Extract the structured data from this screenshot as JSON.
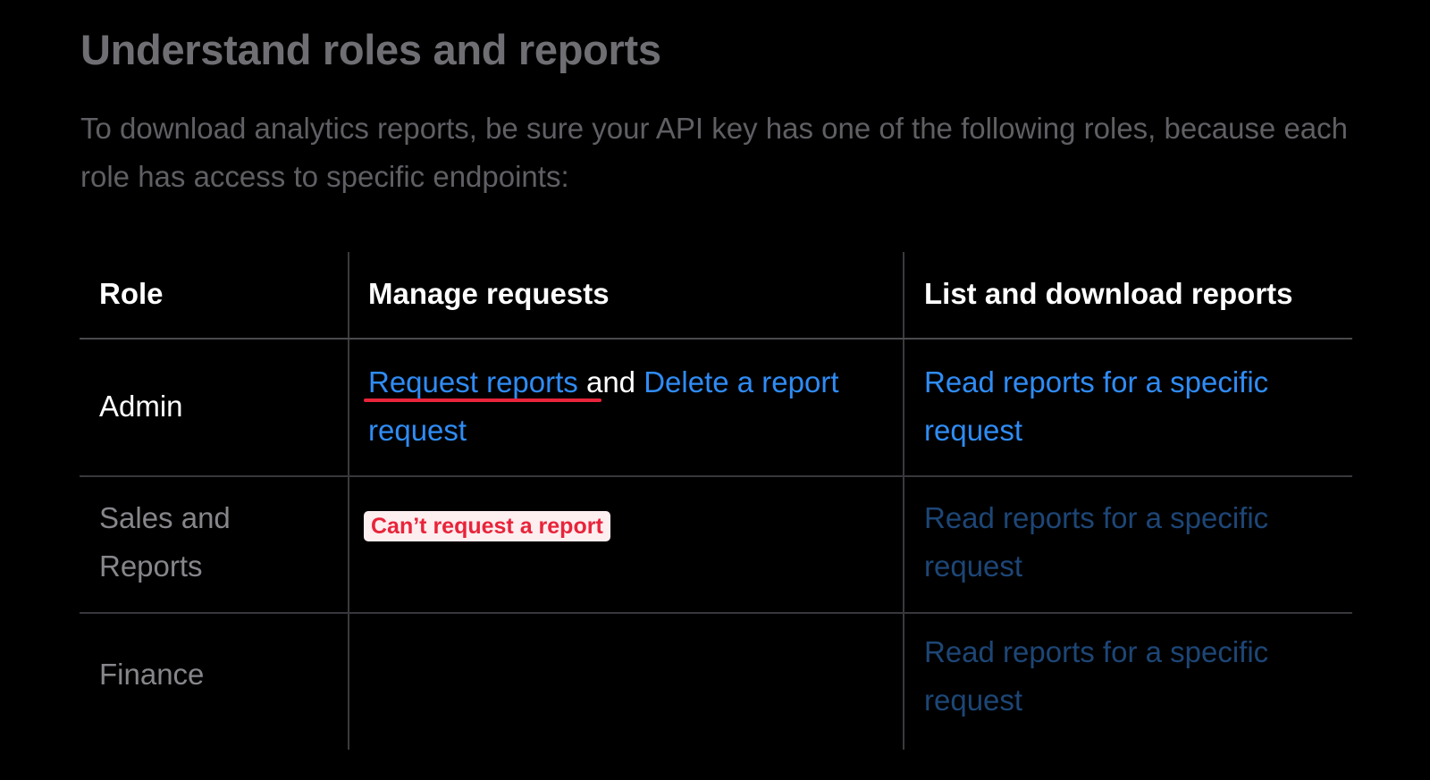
{
  "section": {
    "heading": "Understand roles and reports",
    "intro": "To download analytics reports, be sure your API key has one of the following roles, because each role has access to specific endpoints:"
  },
  "table": {
    "headers": {
      "role": "Role",
      "manage": "Manage requests",
      "list": "List and download reports"
    },
    "rows": [
      {
        "role": "Admin",
        "manage_link_1": "Request reports",
        "manage_conjunction": " and ",
        "manage_link_2": "Delete a report request",
        "list_link": "Read reports for a specific request"
      },
      {
        "role": "Sales and Reports",
        "manage_badge": "Can’t request a report",
        "list_link": "Read reports for a specific request"
      },
      {
        "role": "Finance",
        "manage_text": "",
        "list_link": "Read reports for a specific request"
      }
    ]
  },
  "colors": {
    "background": "#000000",
    "link": "#2f8cf5",
    "link_dimmed": "#1d4676",
    "annotation_red": "#e8243a",
    "badge_background": "#fdeef0"
  }
}
